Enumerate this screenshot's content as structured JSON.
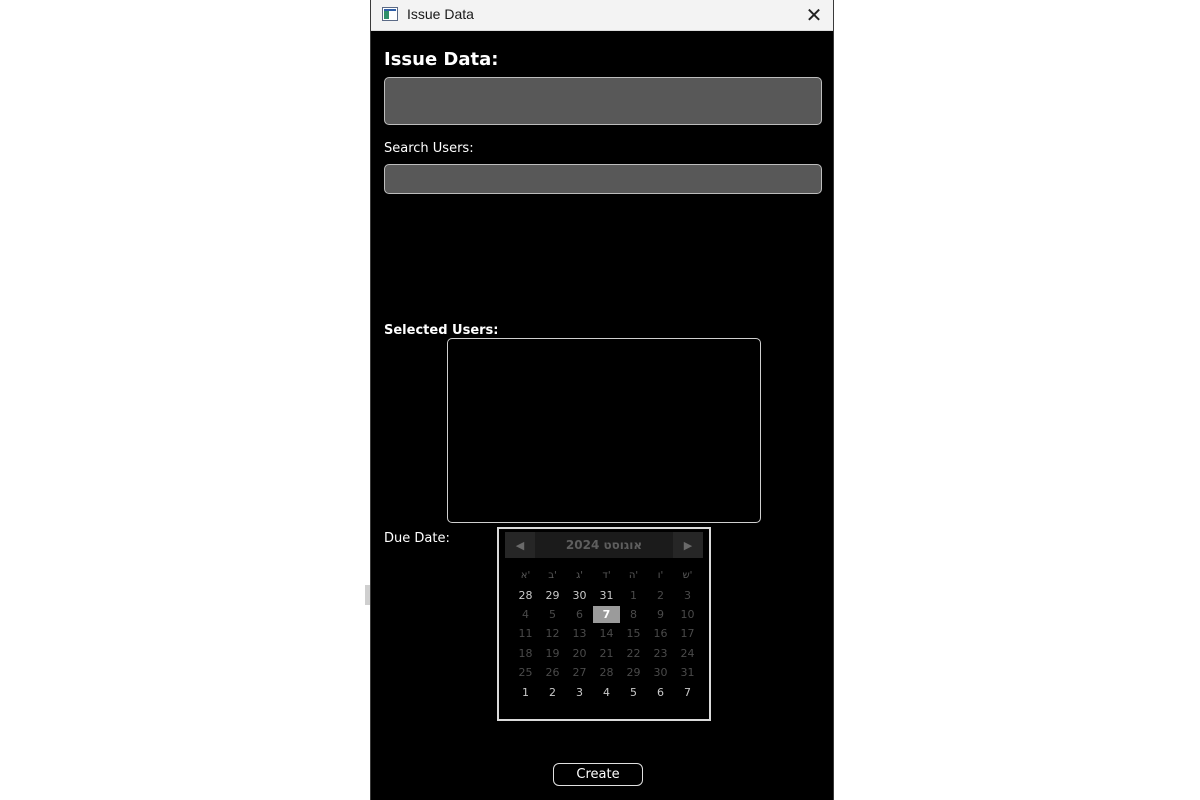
{
  "window": {
    "title": "Issue Data",
    "close_symbol": "✕",
    "icon": "app-window-icon"
  },
  "form": {
    "issue_label": "Issue Data:",
    "issue_value": "",
    "search_label": "Search Users:",
    "search_value": "",
    "selected_label": "Selected Users:",
    "selected_users": [],
    "due_label": "Due Date:",
    "create_label": "Create"
  },
  "calendar": {
    "month_title": "אוגוסט 2024",
    "prev_icon": "◀",
    "next_icon": "▶",
    "weekdays": [
      "א'",
      "ב'",
      "ג'",
      "ד'",
      "ה'",
      "ו'",
      "ש'"
    ],
    "weeks": [
      [
        [
          "28",
          "bright"
        ],
        [
          "29",
          "bright"
        ],
        [
          "30",
          "bright"
        ],
        [
          "31",
          "bright"
        ],
        [
          "1",
          "dim"
        ],
        [
          "2",
          "dim"
        ],
        [
          "3",
          "dim"
        ]
      ],
      [
        [
          "4",
          "dim"
        ],
        [
          "5",
          "dim"
        ],
        [
          "6",
          "dim"
        ],
        [
          "7",
          "selected"
        ],
        [
          "8",
          "dim"
        ],
        [
          "9",
          "dim"
        ],
        [
          "10",
          "dim"
        ]
      ],
      [
        [
          "11",
          "dim"
        ],
        [
          "12",
          "dim"
        ],
        [
          "13",
          "dim"
        ],
        [
          "14",
          "dim"
        ],
        [
          "15",
          "dim"
        ],
        [
          "16",
          "dim"
        ],
        [
          "17",
          "dim"
        ]
      ],
      [
        [
          "18",
          "dim"
        ],
        [
          "19",
          "dim"
        ],
        [
          "20",
          "dim"
        ],
        [
          "21",
          "dim"
        ],
        [
          "22",
          "dim"
        ],
        [
          "23",
          "dim"
        ],
        [
          "24",
          "dim"
        ]
      ],
      [
        [
          "25",
          "dim"
        ],
        [
          "26",
          "dim"
        ],
        [
          "27",
          "dim"
        ],
        [
          "28",
          "dim"
        ],
        [
          "29",
          "dim"
        ],
        [
          "30",
          "dim"
        ],
        [
          "31",
          "dim"
        ]
      ],
      [
        [
          "1",
          "bright"
        ],
        [
          "2",
          "bright"
        ],
        [
          "3",
          "bright"
        ],
        [
          "4",
          "bright"
        ],
        [
          "5",
          "bright"
        ],
        [
          "6",
          "bright"
        ],
        [
          "7",
          "bright"
        ]
      ]
    ],
    "selected_day": "7"
  },
  "colors": {
    "window_bg": "#000000",
    "input_bg": "#585858",
    "input_border": "#bdbdbd",
    "selected_day_bg": "#9b9b9b"
  }
}
